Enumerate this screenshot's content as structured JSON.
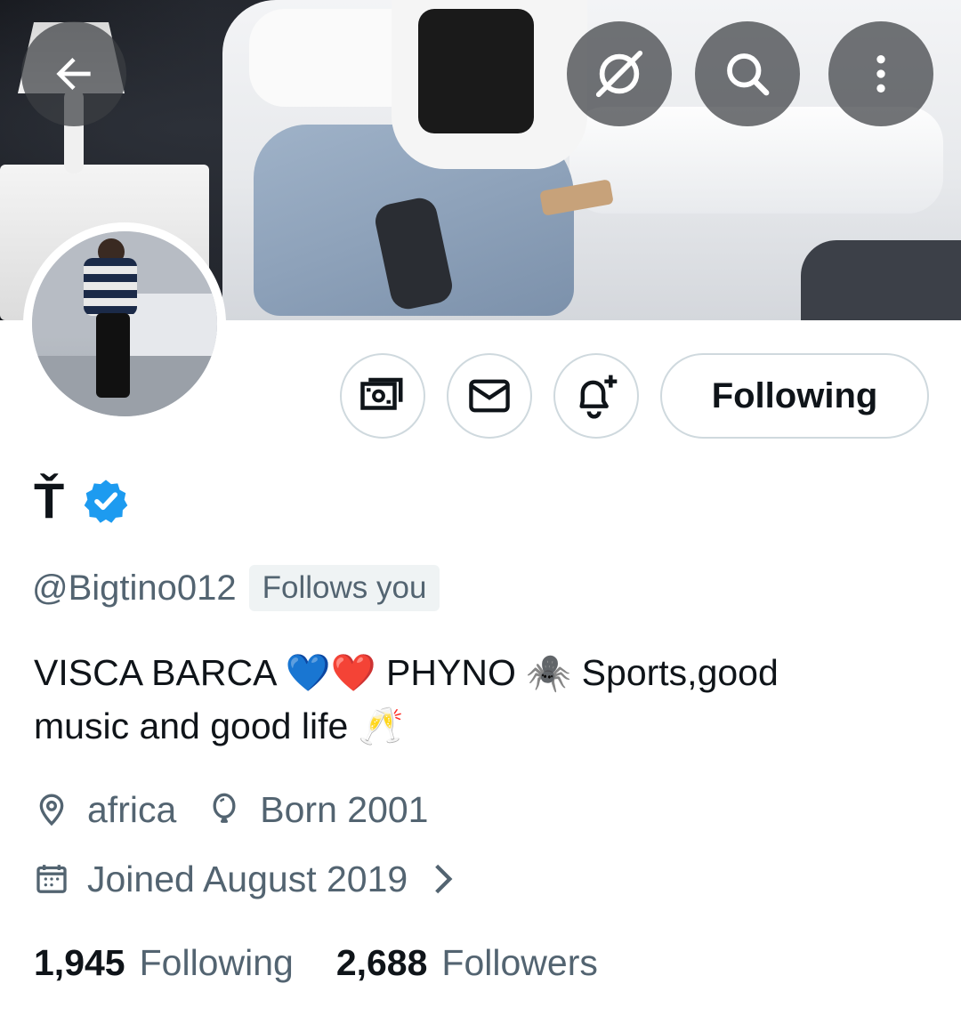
{
  "header": {
    "back_icon": "arrow-left-icon",
    "grok_icon": "grok-icon",
    "search_icon": "search-icon",
    "more_icon": "more-vertical-icon"
  },
  "actions": {
    "tip_icon": "money-icon",
    "message_icon": "envelope-icon",
    "notify_icon": "bell-plus-icon",
    "following_label": "Following"
  },
  "profile": {
    "display_name": "Ť",
    "verified": true,
    "handle": "@Bigtino012",
    "follows_you": "Follows you",
    "bio_line1": "VISCA BARCA 💙❤️ PHYNO 🕷️ Sports,good",
    "bio_line2": "music and good life 🥂",
    "location": "africa",
    "birthday": "Born 2001",
    "joined": "Joined August 2019"
  },
  "stats": {
    "following_count": "1,945",
    "following_label": "Following",
    "followers_count": "2,688",
    "followers_label": "Followers"
  },
  "colors": {
    "text_primary": "#0f1419",
    "text_secondary": "#536471",
    "border": "#cfd9de",
    "verified_blue": "#1d9bf0"
  }
}
